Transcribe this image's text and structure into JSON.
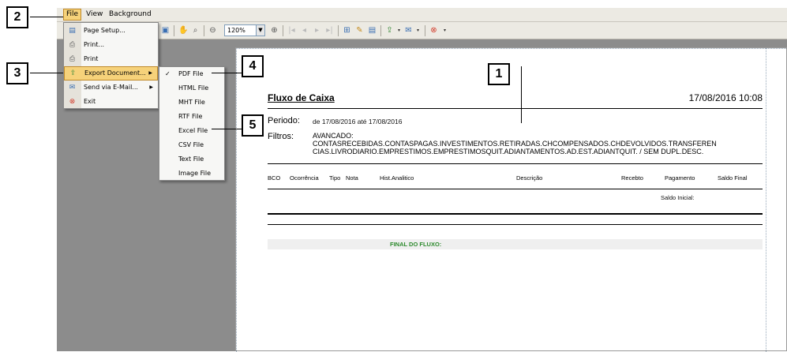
{
  "menubar": {
    "file": "File",
    "view": "View",
    "background": "Background"
  },
  "toolbar": {
    "zoom": "120%"
  },
  "file_menu": [
    {
      "label": "Page Setup...",
      "icon": "page-setup-icon"
    },
    {
      "label": "Print...",
      "icon": "print-dialog-icon"
    },
    {
      "label": "Print",
      "icon": "printer-icon"
    },
    {
      "label": "Export Document...",
      "icon": "export-icon",
      "highlight": true
    },
    {
      "label": "Send via E-Mail...",
      "icon": "email-icon"
    },
    {
      "label": "Exit",
      "icon": "exit-icon"
    }
  ],
  "export_menu": [
    "PDF File",
    "HTML File",
    "MHT File",
    "RTF File",
    "Excel File",
    "CSV File",
    "Text File",
    "Image File"
  ],
  "report": {
    "title": "Fluxo de Caixa",
    "datetime": "17/08/2016 10:08",
    "periodo_label": "Periodo:",
    "periodo_value": "de 17/08/2016 até 17/08/2016",
    "filtros_label": "Filtros:",
    "filtros_line1": "AVANCADO:",
    "filtros_line2": "CONTASRECEBIDAS.CONTASPAGAS.INVESTIMENTOS.RETIRADAS.CHCOMPENSADOS.CHDEVOLVIDOS.TRANSFEREN",
    "filtros_line3": "CIAS.LIVRODIARIO.EMPRESTIMOS.EMPRESTIMOSQUIT.ADIANTAMENTOS.AD.EST.ADIANTQUIT. / SEM DUPL.DESC.",
    "columns": [
      "BCO",
      "Ocorrência",
      "Tipo",
      "Nota",
      "Hist.Analitico",
      "Descrição",
      "Recebto",
      "Pagamento",
      "Saldo Final"
    ],
    "saldo_inicial": "Saldo Inicial:",
    "final": "FINAL DO FLUXO:"
  },
  "callouts": [
    "1",
    "2",
    "3",
    "4",
    "5"
  ],
  "colors": {
    "menu_highlight": "#f6d27a",
    "final_text": "#2e8b2e",
    "viewer_bg": "#8c8c8c"
  }
}
